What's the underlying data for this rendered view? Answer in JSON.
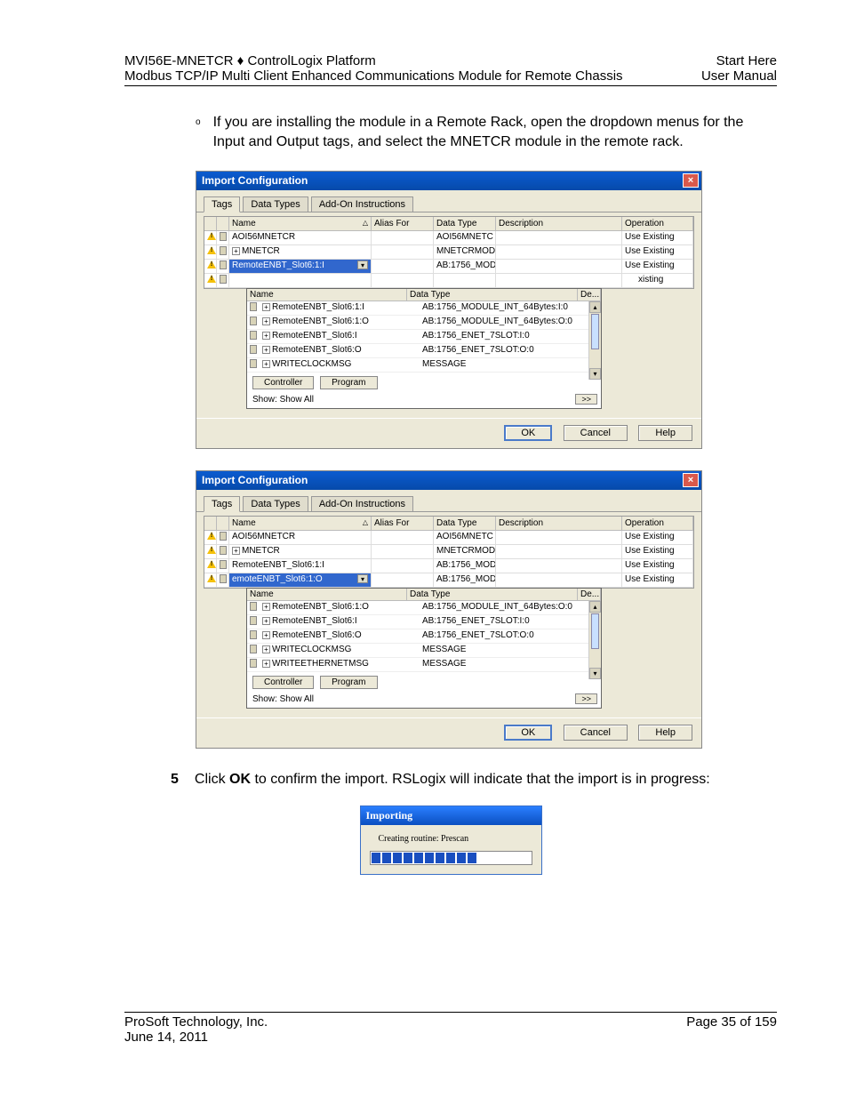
{
  "header": {
    "left_line1": "MVI56E-MNETCR ♦ ControlLogix Platform",
    "left_line2": "Modbus TCP/IP Multi Client Enhanced Communications Module for Remote Chassis",
    "right_line1": "Start Here",
    "right_line2": "User Manual"
  },
  "bullet_text": "If you are installing the module in a Remote Rack, open the dropdown menus for the Input and Output tags, and select the MNETCR module in the remote rack.",
  "dialogs": {
    "title": "Import Configuration",
    "tabs": [
      "Tags",
      "Data Types",
      "Add-On Instructions"
    ],
    "grid_headers": {
      "name": "Name",
      "alias": "Alias For",
      "dtype": "Data Type",
      "desc": "Description",
      "op": "Operation"
    },
    "d1": {
      "rows": [
        {
          "name": "AOI56MNETCR",
          "dtype": "AOI56MNETC",
          "op": "Use Existing"
        },
        {
          "name": "MNETCR",
          "dtype": "MNETCRMOD",
          "op": "Use Existing",
          "expand": true
        },
        {
          "name": "RemoteENBT_Slot6:1:I",
          "dtype": "AB:1756_MOD",
          "op": "Use Existing",
          "hl": true
        },
        {
          "name": "",
          "dtype": "",
          "op": "xisting"
        }
      ],
      "dd_header": {
        "name": "Name",
        "dtype": "Data Type",
        "de": "De..."
      },
      "dd_items": [
        {
          "name": "RemoteENBT_Slot6:1:I",
          "dtype": "AB:1756_MODULE_INT_64Bytes:I:0"
        },
        {
          "name": "RemoteENBT_Slot6:1:O",
          "dtype": "AB:1756_MODULE_INT_64Bytes:O:0"
        },
        {
          "name": "RemoteENBT_Slot6:I",
          "dtype": "AB:1756_ENET_7SLOT:I:0"
        },
        {
          "name": "RemoteENBT_Slot6:O",
          "dtype": "AB:1756_ENET_7SLOT:O:0"
        },
        {
          "name": "WRITECLOCKMSG",
          "dtype": "MESSAGE"
        }
      ]
    },
    "d2": {
      "rows": [
        {
          "name": "AOI56MNETCR",
          "dtype": "AOI56MNETC",
          "op": "Use Existing"
        },
        {
          "name": "MNETCR",
          "dtype": "MNETCRMOD",
          "op": "Use Existing",
          "expand": true
        },
        {
          "name": "RemoteENBT_Slot6:1:I",
          "dtype": "AB:1756_MOD",
          "op": "Use Existing"
        },
        {
          "name": "emoteENBT_Slot6:1:O",
          "dtype": "AB:1756_MOD",
          "op": "Use Existing",
          "hl": true
        }
      ],
      "dd_header": {
        "name": "Name",
        "dtype": "Data Type",
        "de": "De..."
      },
      "dd_items": [
        {
          "name": "RemoteENBT_Slot6:1:O",
          "dtype": "AB:1756_MODULE_INT_64Bytes:O:0"
        },
        {
          "name": "RemoteENBT_Slot6:I",
          "dtype": "AB:1756_ENET_7SLOT:I:0"
        },
        {
          "name": "RemoteENBT_Slot6:O",
          "dtype": "AB:1756_ENET_7SLOT:O:0"
        },
        {
          "name": "WRITECLOCKMSG",
          "dtype": "MESSAGE"
        },
        {
          "name": "WRITEETHERNETMSG",
          "dtype": "MESSAGE"
        }
      ]
    },
    "dd_buttons": {
      "controller": "Controller",
      "program": "Program"
    },
    "dd_show": "Show: Show All",
    "dd_more": ">>",
    "buttons": {
      "ok": "OK",
      "cancel": "Cancel",
      "help": "Help"
    }
  },
  "step5": {
    "num": "5",
    "pre": "Click ",
    "bold": "OK",
    "post": " to confirm the import. RSLogix will indicate that the import is in progress:"
  },
  "importing": {
    "title": "Importing",
    "msg": "Creating routine: Prescan"
  },
  "footer": {
    "left_line1": "ProSoft Technology, Inc.",
    "left_line2": "June 14, 2011",
    "right": "Page 35 of 159"
  }
}
